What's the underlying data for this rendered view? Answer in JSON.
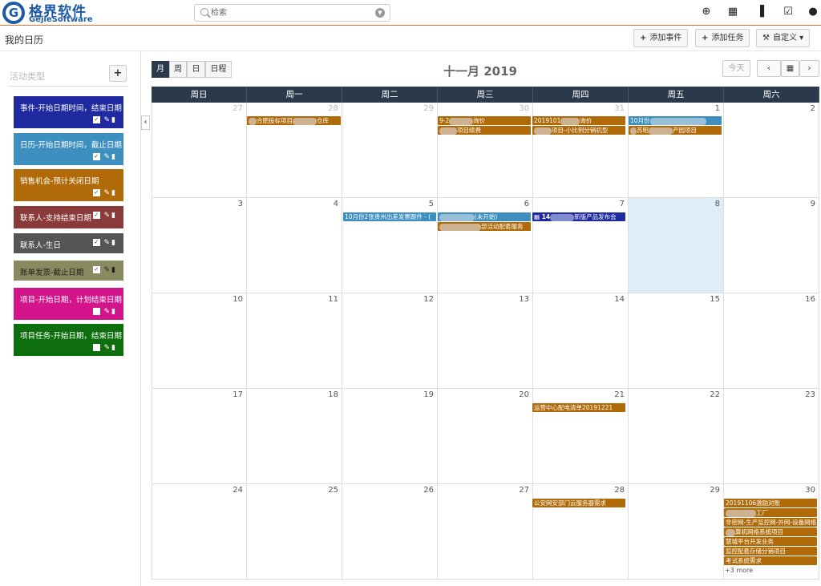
{
  "app": {
    "logo_cn": "格界软件",
    "logo_en": "GejieSoftware",
    "logo_mark": "G"
  },
  "search": {
    "placeholder": "检索"
  },
  "page_title": "我的日历",
  "toolbar": {
    "add_event": "添加事件",
    "add_task": "添加任务",
    "customize": "自定义"
  },
  "sidebar": {
    "title": "活动类型",
    "add": "+",
    "types": [
      {
        "label": "事件-开始日期时间，结束日期",
        "color": "#1f2aa0",
        "checked": true
      },
      {
        "label": "日历-开始日期时间，截止日期",
        "color": "#3d8fbf",
        "checked": true
      },
      {
        "label": "销售机会-预计关闭日期",
        "color": "#b06a08",
        "checked": true
      },
      {
        "label": "联系人-支持结束日期",
        "color": "#8a3a38",
        "checked": true
      },
      {
        "label": "联系人-生日",
        "color": "#555555",
        "checked": true
      },
      {
        "label": "账单发票-截止日期",
        "color": "#8a8a60",
        "checked": true,
        "dark": true
      },
      {
        "label": "项目-开始日期，计划结束日期",
        "color": "#d4148a",
        "checked": false
      },
      {
        "label": "项目任务-开始日期，结束日期",
        "color": "#0c6e0c",
        "checked": false
      }
    ]
  },
  "calendar": {
    "views": [
      "月",
      "周",
      "日",
      "日程"
    ],
    "active_view": "月",
    "title": "十一月 2019",
    "today": "今天",
    "dow": [
      "周日",
      "周一",
      "周二",
      "周三",
      "周四",
      "周五",
      "周六"
    ],
    "weeks": [
      [
        "27",
        "28",
        "29",
        "30",
        "31",
        "1",
        "2"
      ],
      [
        "3",
        "4",
        "5",
        "6",
        "7",
        "8",
        "9"
      ],
      [
        "10",
        "11",
        "12",
        "13",
        "14",
        "15",
        "16"
      ],
      [
        "17",
        "18",
        "19",
        "20",
        "21",
        "22",
        "23"
      ],
      [
        "24",
        "25",
        "26",
        "27",
        "28",
        "29",
        "30"
      ]
    ],
    "events": {
      "e1": "合肥投标项目",
      "e1b": "仓库",
      "e2": "9-2",
      "e2b": "询价",
      "e3": "项目续费",
      "e4": "2019101",
      "e4b": "询价",
      "e5": "项目-小比例分销机型",
      "e6": "10月份",
      "e7": "苏昭",
      "e7b": "产园项目",
      "e8": "10月份2张贵州出差发票跟件 - (",
      "e9": "(未开始)",
      "e10": "部活动配套服务",
      "e11": "14",
      "e11b": "新版产品发布会",
      "e12": "运营中心配电清单20191221",
      "e13": "公安网安部门云服务器需求",
      "e14": "20191106激励对账",
      "e15": "工厂",
      "e16": "非密网-生产监控网-外网-设备网络",
      "e17": "算机网络系统项目",
      "e18": "慧城平台开发业务",
      "e19": "监控配套存储分销项目",
      "e20": "考试系统需求",
      "more": "+3 more"
    }
  }
}
